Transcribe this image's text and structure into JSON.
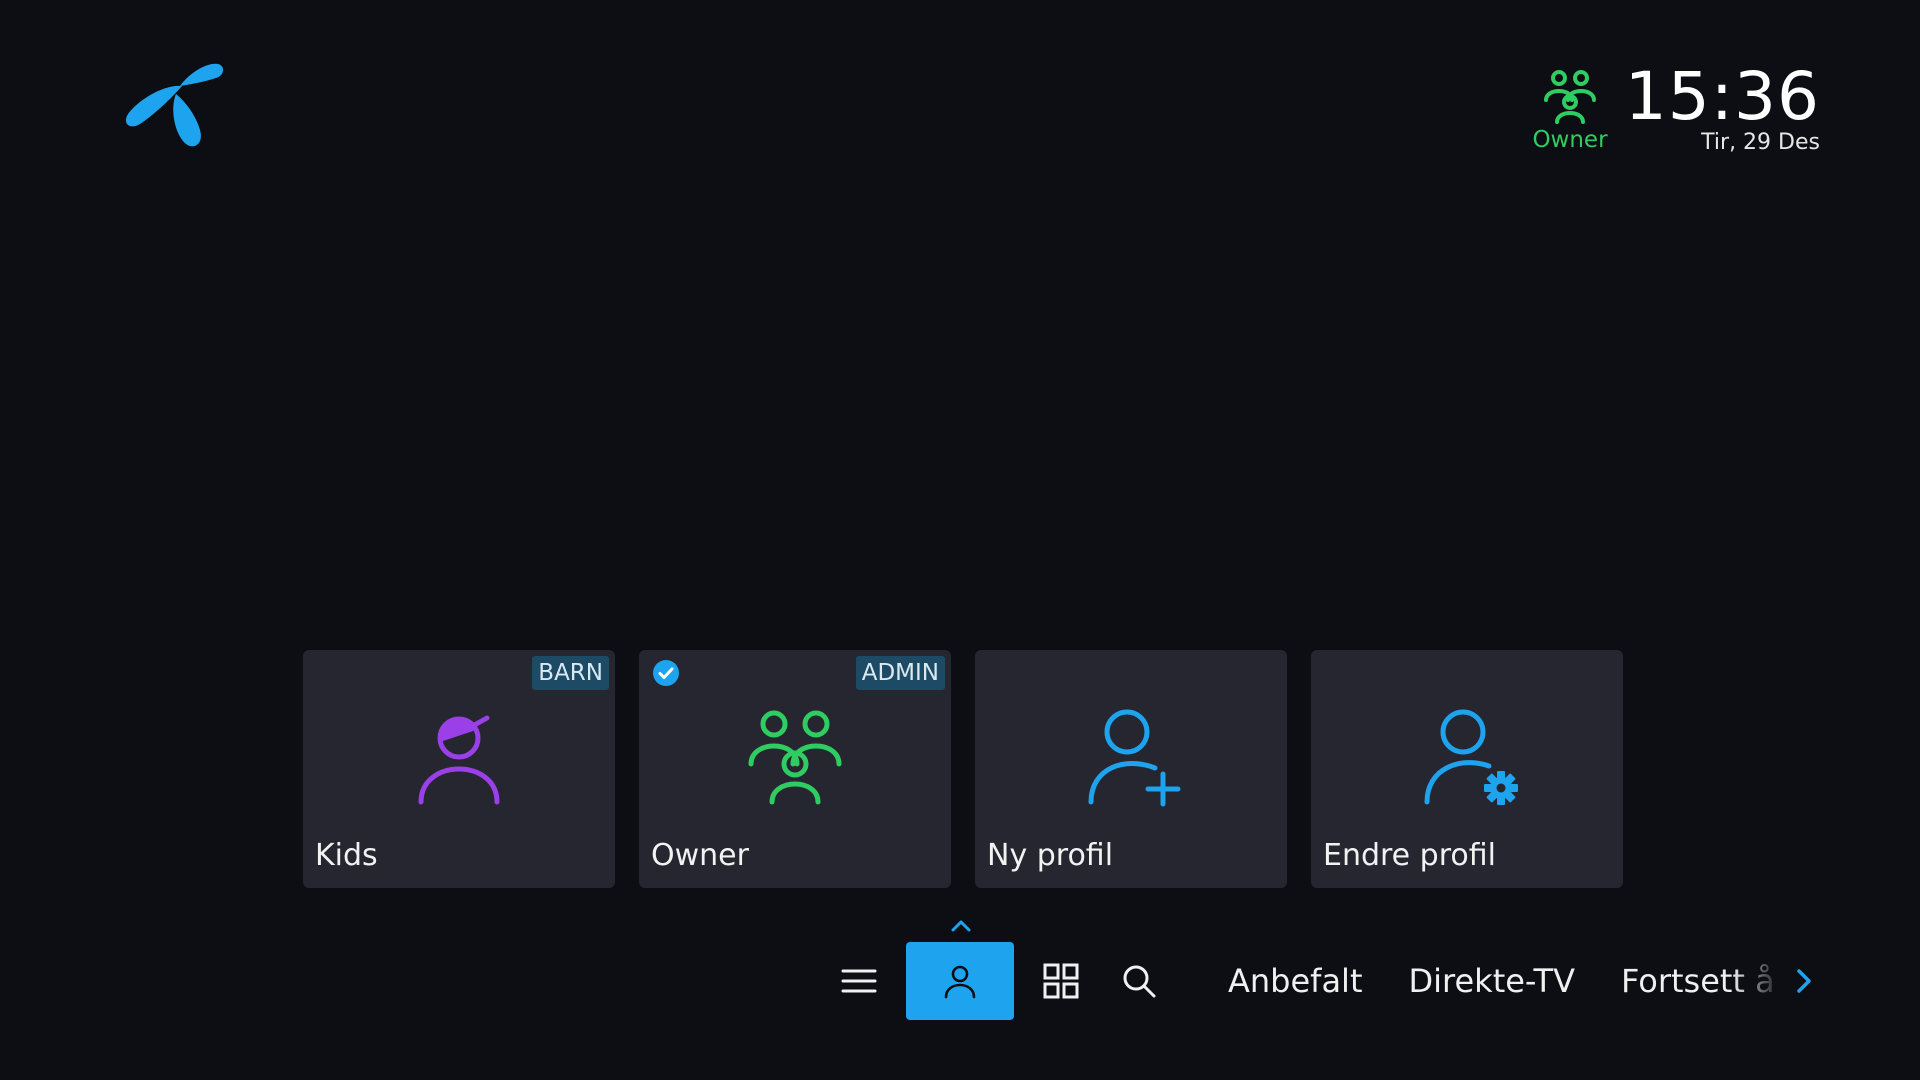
{
  "header": {
    "logo_icon": "telenor-logo-icon",
    "profile_icon": "family-group-icon",
    "profile_name": "Owner",
    "time": "15:36",
    "date": "Tir, 29 Des"
  },
  "profiles": [
    {
      "label": "Kids",
      "badge": "BARN",
      "icon": "kid-cap-icon",
      "color": "#9b3fe8",
      "selected": false
    },
    {
      "label": "Owner",
      "badge": "ADMIN",
      "icon": "family-group-icon",
      "color": "#2ecc61",
      "selected": true
    },
    {
      "label": "Ny profil",
      "badge": "",
      "icon": "add-user-icon",
      "color": "#1ea3ef",
      "selected": false
    },
    {
      "label": "Endre profil",
      "badge": "",
      "icon": "user-settings-icon",
      "color": "#1ea3ef",
      "selected": false
    }
  ],
  "nav": {
    "icons": [
      "menu-icon",
      "profile-icon",
      "grid-icon",
      "search-icon"
    ],
    "items": [
      "Anbefalt",
      "Direkte-TV",
      "Fortsett å"
    ],
    "active": "profile-icon"
  },
  "colors": {
    "accent": "#1ea3ef",
    "owner": "#2ecc61",
    "kids": "#9b3fe8",
    "background": "#0c0e13",
    "card": "#252630"
  }
}
